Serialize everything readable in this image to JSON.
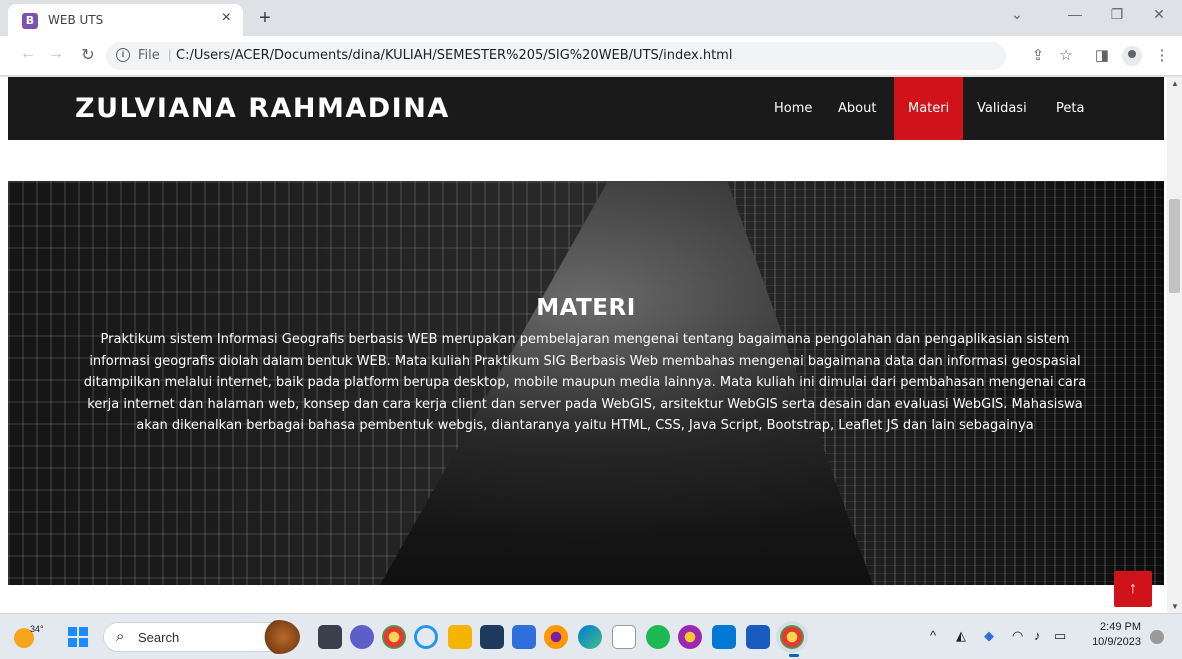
{
  "browser": {
    "tab_title": "WEB UTS",
    "tab_favicon": "B",
    "new_tab": "+",
    "url_scheme": "File",
    "url_path": "C:/Users/ACER/Documents/dina/KULIAH/SEMESTER%205/SIG%20WEB/UTS/index.html"
  },
  "site": {
    "brand": "ZULVIANA RAHMADINA",
    "menu": [
      "Home",
      "About",
      "Materi",
      "Validasi",
      "Peta"
    ],
    "active_menu": "Materi",
    "accent_color": "#d0131b"
  },
  "hero": {
    "title": "MATERI",
    "text": "Praktikum sistem Informasi Geografis berbasis WEB merupakan pembelajaran mengenai tentang bagaimana pengolahan dan pengaplikasian sistem informasi geografis diolah dalam bentuk WEB. Mata kuliah Praktikum SIG Berbasis Web membahas mengenai bagaimana data dan informasi geospasial ditampilkan melalui internet, baik pada platform berupa desktop, mobile maupun media lainnya. Mata kuliah ini dimulai dari pembahasan mengenai cara kerja internet dan halaman web, konsep dan cara kerja client dan server pada WebGIS, arsitektur WebGIS serta desain dan evaluasi WebGIS. Mahasiswa akan dikenalkan berbagai bahasa pembentuk webgis, diantaranya yaitu HTML, CSS, Java Script, Bootstrap, Leaflet JS dan lain sebagainya"
  },
  "back_to_top": "↑",
  "taskbar": {
    "weather_temp": "34°",
    "search_label": "Search",
    "time": "2:49 PM",
    "date": "10/9/2023"
  }
}
